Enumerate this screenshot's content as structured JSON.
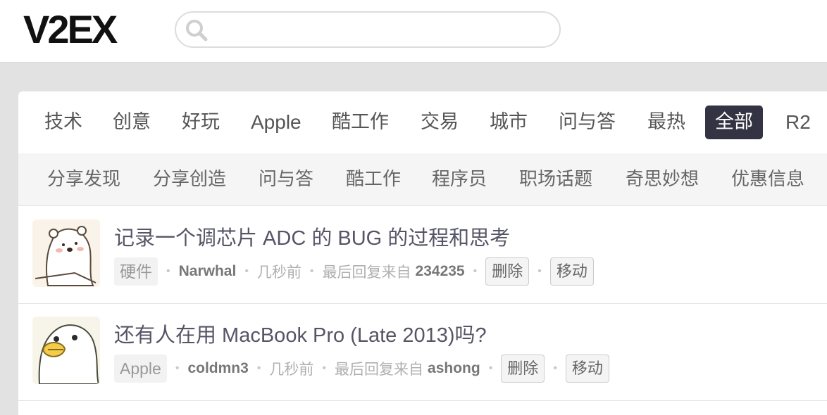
{
  "header": {
    "logo_text": "V2EX",
    "search_placeholder": ""
  },
  "tabs": [
    {
      "label": "技术"
    },
    {
      "label": "创意"
    },
    {
      "label": "好玩"
    },
    {
      "label": "Apple"
    },
    {
      "label": "酷工作"
    },
    {
      "label": "交易"
    },
    {
      "label": "城市"
    },
    {
      "label": "问与答"
    },
    {
      "label": "最热"
    },
    {
      "label": "全部",
      "active": true
    },
    {
      "label": "R2"
    }
  ],
  "subtabs": [
    {
      "label": "分享发现"
    },
    {
      "label": "分享创造"
    },
    {
      "label": "问与答"
    },
    {
      "label": "酷工作"
    },
    {
      "label": "程序员"
    },
    {
      "label": "职场话题"
    },
    {
      "label": "奇思妙想"
    },
    {
      "label": "优惠信息"
    }
  ],
  "topics": [
    {
      "title": "记录一个调芯片 ADC 的 BUG 的过程和思考",
      "node": "硬件",
      "author": "Narwhal",
      "time": "几秒前",
      "last_reply_prefix": "最后回复来自",
      "last_reply_user": "234235",
      "delete_label": "删除",
      "move_label": "移动",
      "avatar_icon": "polar-bear-avatar-icon"
    },
    {
      "title": "还有人在用 MacBook Pro (Late 2013)吗?",
      "node": "Apple",
      "author": "coldmn3",
      "time": "几秒前",
      "last_reply_prefix": "最后回复来自",
      "last_reply_user": "ashong",
      "delete_label": "删除",
      "move_label": "移动",
      "avatar_icon": "duck-avatar-icon"
    }
  ],
  "colors": {
    "active_tab_bg": "#333344",
    "page_bg": "#e2e2e2"
  }
}
